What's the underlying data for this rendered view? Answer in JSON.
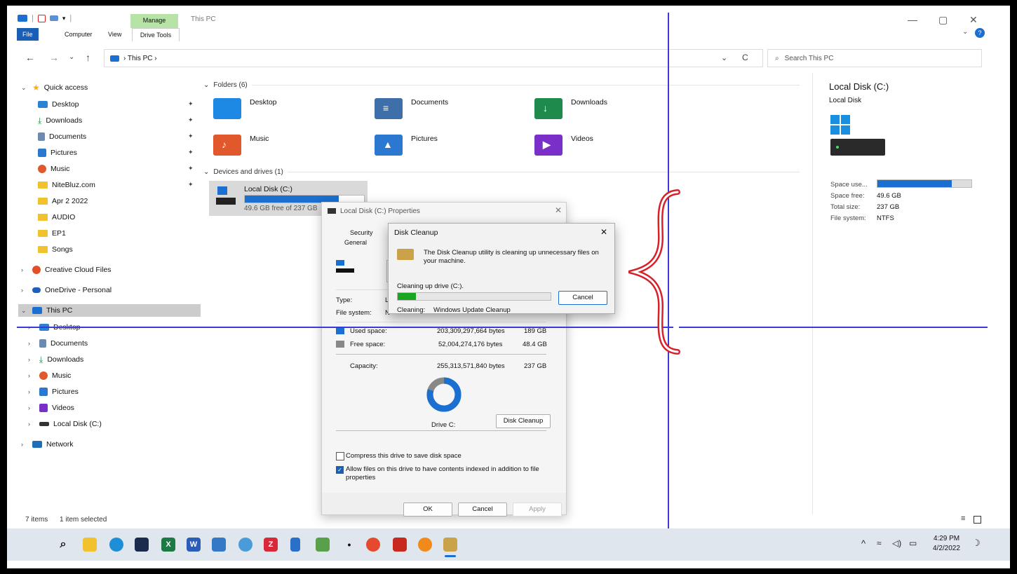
{
  "window": {
    "title": "This PC",
    "manage_tab": "Manage",
    "tabs": [
      "File",
      "Computer",
      "View",
      "Drive Tools"
    ],
    "minimize": "—",
    "restore": "▢",
    "close": "✕"
  },
  "nav": {
    "back": "←",
    "forward": "→",
    "recent": "⌄",
    "up": "↑",
    "breadcrumb": "› This PC ›",
    "dropdown": "⌄",
    "refresh": "C",
    "search_placeholder": "Search This PC"
  },
  "sidebar": {
    "quick_access": "Quick access",
    "quick_items": [
      "Desktop",
      "Downloads",
      "Documents",
      "Pictures",
      "Music",
      "NiteBluz.com",
      "Apr 2 2022",
      "AUDIO",
      "EP1",
      "Songs"
    ],
    "creative_cloud": "Creative Cloud Files",
    "onedrive": "OneDrive - Personal",
    "this_pc": "This PC",
    "pc_items": [
      "Desktop",
      "Documents",
      "Downloads",
      "Music",
      "Pictures",
      "Videos",
      "Local Disk (C:)"
    ],
    "network": "Network"
  },
  "main": {
    "folders_header": "Folders (6)",
    "folders": [
      "Desktop",
      "Documents",
      "Downloads",
      "Music",
      "Pictures",
      "Videos"
    ],
    "devices_header": "Devices and drives (1)",
    "drive_name": "Local Disk (C:)",
    "drive_free": "49.6 GB free of 237 GB",
    "drive_used_fraction": 0.79
  },
  "details": {
    "title": "Local Disk (C:)",
    "subtitle": "Local Disk",
    "space_used_label": "Space use...",
    "space_free_label": "Space free:",
    "space_free": "49.6 GB",
    "total_size_label": "Total size:",
    "total_size": "237 GB",
    "fs_label": "File system:",
    "fs": "NTFS"
  },
  "properties": {
    "title": "Local Disk (C:) Properties",
    "tab_security": "Security",
    "tab_general": "General",
    "type_label": "Type:",
    "type_value": "L",
    "fs_label": "File system:",
    "fs_value": "N",
    "used_label": "Used space:",
    "used_bytes": "203,309,297,664 bytes",
    "used_gb": "189 GB",
    "free_label": "Free space:",
    "free_bytes": "52,004,274,176 bytes",
    "free_gb": "48.4 GB",
    "capacity_label": "Capacity:",
    "capacity_bytes": "255,313,571,840 bytes",
    "capacity_gb": "237 GB",
    "drive_label": "Drive C:",
    "disk_cleanup_btn": "Disk Cleanup",
    "compress_label": "Compress this drive to save disk space",
    "index_label": "Allow files on this drive to have contents indexed in addition to file properties",
    "ok": "OK",
    "cancel": "Cancel",
    "apply": "Apply",
    "used_fraction": 0.8
  },
  "disk_cleanup": {
    "title": "Disk Cleanup",
    "message": "The Disk Cleanup utility is cleaning up unnecessary files on your machine.",
    "cleaning_drive": "Cleaning up drive  (C:).",
    "cancel": "Cancel",
    "cleaning_label": "Cleaning:",
    "cleaning_item": "Windows Update Cleanup",
    "progress_fraction": 0.12
  },
  "status": {
    "items": "7 items",
    "selected": "1 item selected"
  },
  "taskbar": {
    "time": "4:29 PM",
    "date": "4/2/2022"
  },
  "colors": {
    "accent": "#1a6fd1",
    "manage_green": "#b8e3a6",
    "annotation_blue": "#3a3ad8",
    "annotation_red": "#d8202a"
  }
}
